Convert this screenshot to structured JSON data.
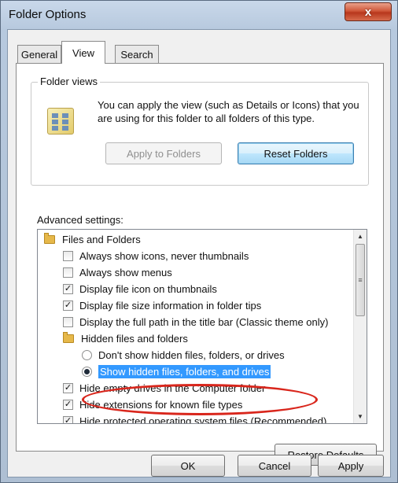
{
  "window": {
    "title": "Folder Options",
    "close_glyph": "x"
  },
  "tabs": [
    {
      "label": "General"
    },
    {
      "label": "View"
    },
    {
      "label": "Search"
    }
  ],
  "folder_views": {
    "group_label": "Folder views",
    "description": "You can apply the view (such as Details or Icons) that you are using for this folder to all folders of this type.",
    "apply_button": "Apply to Folders",
    "reset_button": "Reset Folders"
  },
  "advanced": {
    "label": "Advanced settings:",
    "items": [
      {
        "type": "folder",
        "label": "Files and Folders"
      },
      {
        "type": "checkbox",
        "checked": false,
        "label": "Always show icons, never thumbnails"
      },
      {
        "type": "checkbox",
        "checked": false,
        "label": "Always show menus"
      },
      {
        "type": "checkbox",
        "checked": true,
        "label": "Display file icon on thumbnails"
      },
      {
        "type": "checkbox",
        "checked": true,
        "label": "Display file size information in folder tips"
      },
      {
        "type": "checkbox",
        "checked": false,
        "label": "Display the full path in the title bar (Classic theme only)"
      },
      {
        "type": "folder",
        "label": "Hidden files and folders"
      },
      {
        "type": "radio",
        "checked": false,
        "label": "Don't show hidden files, folders, or drives"
      },
      {
        "type": "radio",
        "checked": true,
        "label": "Show hidden files, folders, and drives"
      },
      {
        "type": "checkbox",
        "checked": true,
        "label": "Hide empty drives in the Computer folder"
      },
      {
        "type": "checkbox",
        "checked": true,
        "label": "Hide extensions for known file types"
      },
      {
        "type": "checkbox",
        "checked": true,
        "label": "Hide protected operating system files (Recommended)"
      }
    ],
    "check_glyph": "✓"
  },
  "restore_defaults": "Restore Defaults",
  "footer": {
    "ok": "OK",
    "cancel": "Cancel",
    "apply": "Apply"
  },
  "colors": {
    "highlight_oval": "#d9261c",
    "selection": "#3399ff"
  }
}
